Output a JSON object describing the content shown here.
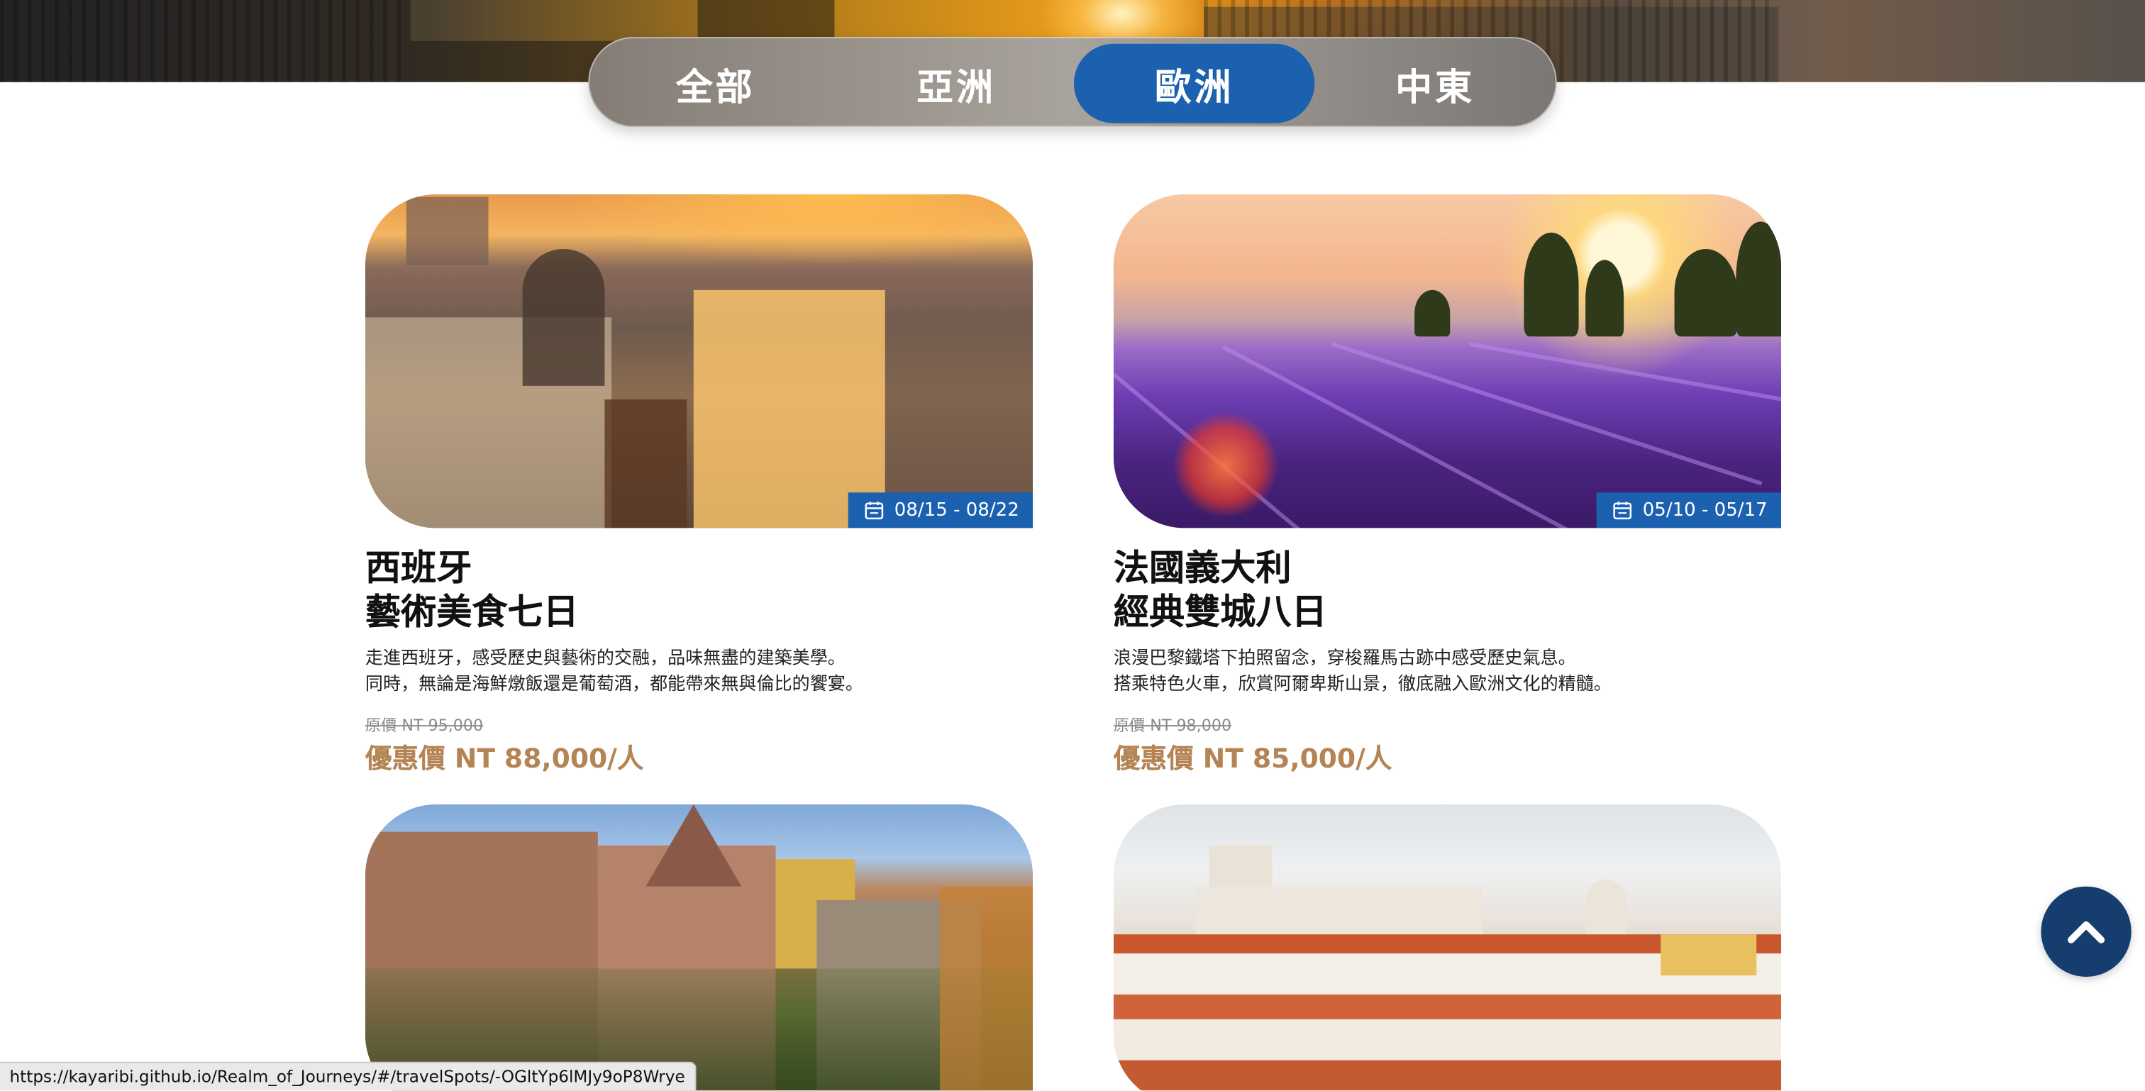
{
  "tabs": [
    {
      "label": "全部",
      "active": false
    },
    {
      "label": "亞洲",
      "active": false
    },
    {
      "label": "歐洲",
      "active": true
    },
    {
      "label": "中東",
      "active": false
    }
  ],
  "cards": [
    {
      "title_line1": "西班牙",
      "title_line2": "藝術美食七日",
      "desc_line1": "走進西班牙，感受歷史與藝術的交融，品味無盡的建築美學。",
      "desc_line2": "同時，無論是海鮮燉飯還是葡萄酒，都能帶來無與倫比的饗宴。",
      "date_range": "08/15 - 08/22",
      "original_price": "原價 NT 95,000",
      "sale_price": "優惠價 NT 88,000/人"
    },
    {
      "title_line1": "法國義大利",
      "title_line2": "經典雙城八日",
      "desc_line1": "浪漫巴黎鐵塔下拍照留念，穿梭羅馬古跡中感受歷史氣息。",
      "desc_line2": "搭乘特色火車，欣賞阿爾卑斯山景，徹底融入歐洲文化的精髓。",
      "date_range": "05/10 - 05/17",
      "original_price": "原價 NT 98,000",
      "sale_price": "優惠價 NT 85,000/人"
    }
  ],
  "status_url": "https://kayaribi.github.io/Realm_of_Journeys/#/travelSpots/-OGltYp6lMJy9oP8Wrye",
  "colors": {
    "accent_blue": "#1b61b0",
    "price": "#b58454",
    "top_button": "#153d6e"
  }
}
